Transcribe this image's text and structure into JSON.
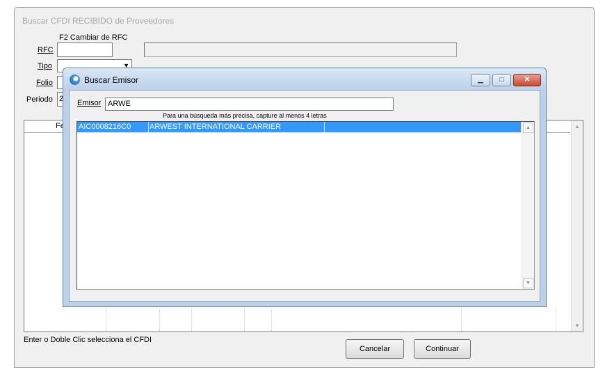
{
  "main_window": {
    "title": "Buscar CFDI RECIBIDO de Proveedores",
    "hint_f2": "F2 Cambiar de RFC",
    "labels": {
      "rfc": "RFC",
      "tipo": "Tipo",
      "folio": "Folio",
      "periodo": "Periodo"
    },
    "rfc_value": "",
    "rfc_name": "",
    "tipo_value": "",
    "tipo_arrow": "▼",
    "periodo_value": "2",
    "grid_header_fragment": "Fe",
    "status_text": "Enter o Doble Clic selecciona el CFDI",
    "buttons": {
      "cancel": "Cancelar",
      "continue": "Continuar"
    }
  },
  "dialog": {
    "title": "Buscar Emisor",
    "emisor_label": "Emisor",
    "emisor_value": "ARWE",
    "search_hint": "Para una búsqueda más precisa, capture al menos 4 letras",
    "results": [
      {
        "rfc": "AIC0008216C0",
        "name": "ARWEST INTERNATIONAL CARRIER",
        "selected": true
      }
    ],
    "window_buttons": {
      "minimize": "▁",
      "maximize": "□",
      "close": "✕"
    }
  },
  "scroll_arrows": {
    "up": "▲",
    "down": "▼"
  },
  "colors": {
    "selection": "#3399ff",
    "dialog_frame": "#bcd0e8",
    "close_button": "#c9482f"
  }
}
